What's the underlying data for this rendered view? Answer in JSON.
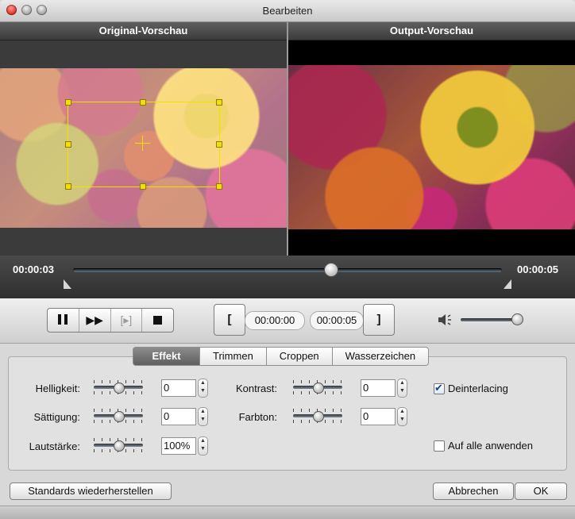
{
  "window": {
    "title": "Bearbeiten"
  },
  "preview": {
    "original_label": "Original-Vorschau",
    "output_label": "Output-Vorschau"
  },
  "timeline": {
    "start_time": "00:00:03",
    "end_time": "00:00:05",
    "playhead_fraction": 0.6
  },
  "controls": {
    "pause_icon": "pause-icon",
    "fast_forward_icon": "fast-forward-icon",
    "step_icon": "step-icon",
    "stop_icon": "stop-icon",
    "mark_in_label": "[",
    "mark_out_label": "]",
    "time_in": "00:00:00",
    "time_out": "00:00:05",
    "volume_fraction": 0.9
  },
  "tabs": [
    {
      "label": "Effekt",
      "active": true
    },
    {
      "label": "Trimmen",
      "active": false
    },
    {
      "label": "Croppen",
      "active": false
    },
    {
      "label": "Wasserzeichen",
      "active": false
    }
  ],
  "effect": {
    "brightness": {
      "label": "Helligkeit:",
      "value": "0"
    },
    "saturation": {
      "label": "Sättigung:",
      "value": "0"
    },
    "volume": {
      "label": "Lautstärke:",
      "value": "100%"
    },
    "contrast": {
      "label": "Kontrast:",
      "value": "0"
    },
    "hue": {
      "label": "Farbton:",
      "value": "0"
    },
    "deinterlacing": {
      "label": "Deinterlacing",
      "checked": true
    },
    "apply_all": {
      "label": "Auf alle anwenden",
      "checked": false
    }
  },
  "footer": {
    "restore_label": "Standards wiederherstellen",
    "cancel_label": "Abbrechen",
    "ok_label": "OK"
  },
  "colors": {
    "crop_frame": "#f2e000",
    "active_tab": "#6f6f6f"
  }
}
